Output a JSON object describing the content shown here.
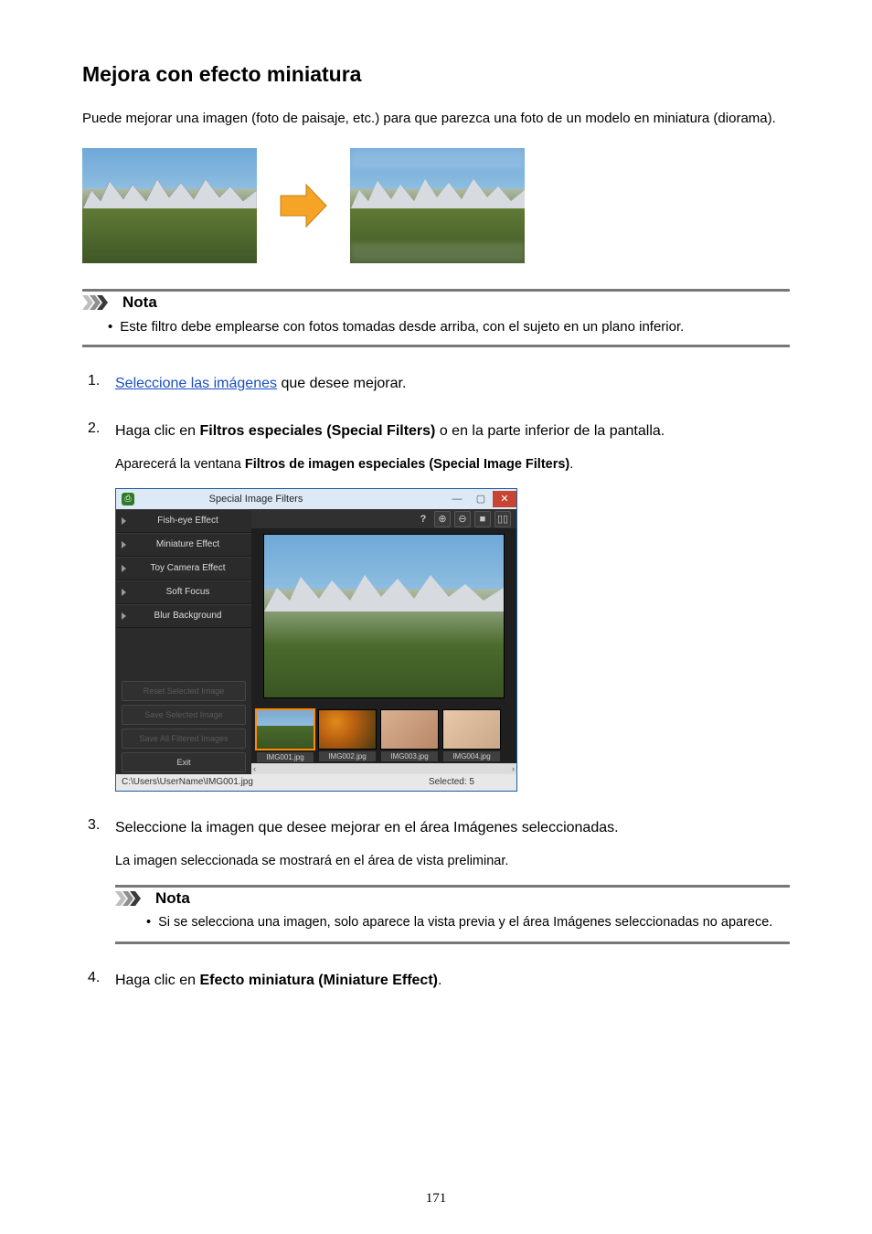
{
  "heading": "Mejora con efecto miniatura",
  "intro": "Puede mejorar una imagen (foto de paisaje, etc.) para que parezca una foto de un modelo en miniatura (diorama).",
  "note1": {
    "title": "Nota",
    "bullet": "Este filtro debe emplearse con fotos tomadas desde arriba, con el sujeto en un plano inferior."
  },
  "steps": {
    "s1_link": "Seleccione las imágenes",
    "s1_rest": " que desee mejorar.",
    "s2_a": "Haga clic en ",
    "s2_bold": "Filtros especiales (Special Filters)",
    "s2_b": " o en la parte inferior de la pantalla.",
    "s2_sub_a": "Aparecerá la ventana ",
    "s2_sub_bold": "Filtros de imagen especiales (Special Image Filters)",
    "s2_sub_b": ".",
    "s3": "Seleccione la imagen que desee mejorar en el área Imágenes seleccionadas.",
    "s3_sub": "La imagen seleccionada se mostrará en el área de vista preliminar.",
    "s3_note_title": "Nota",
    "s3_note_bullet": "Si se selecciona una imagen, solo aparece la vista previa y el área Imágenes seleccionadas no aparece.",
    "s4_a": "Haga clic en ",
    "s4_bold": "Efecto miniatura (Miniature Effect)",
    "s4_b": "."
  },
  "app": {
    "title": "Special Image Filters",
    "filters": [
      "Fish-eye Effect",
      "Miniature Effect",
      "Toy Camera Effect",
      "Soft Focus",
      "Blur Background"
    ],
    "side_buttons": {
      "reset": "Reset Selected Image",
      "save_sel": "Save Selected Image",
      "save_all": "Save All Filtered Images",
      "exit": "Exit"
    },
    "toolbar_help": "?",
    "thumbs": [
      "IMG001.jpg",
      "IMG002.jpg",
      "IMG003.jpg",
      "IMG004.jpg"
    ],
    "status_path": "C:\\Users\\UserName\\IMG001.jpg",
    "status_selected": "Selected: 5"
  },
  "page_number": "171"
}
